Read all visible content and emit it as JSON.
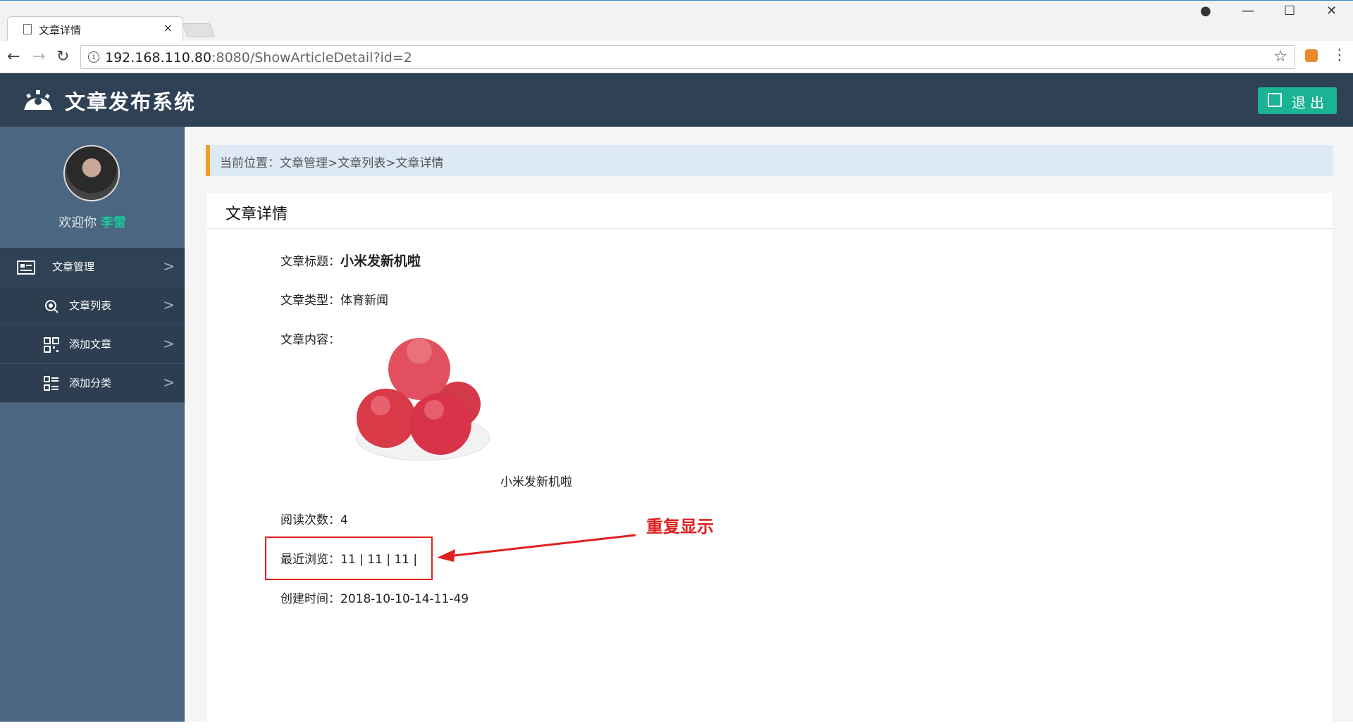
{
  "browser": {
    "tab_title": "文章详情",
    "tab_close": "×",
    "url_host": "192.168.110.80",
    "url_path": ":8080/ShowArticleDetail?id=2",
    "info_icon": "i",
    "star_icon": "☆",
    "menu_icon": "⋮",
    "window_controls": {
      "account": "●",
      "minimize": "—",
      "maximize": "☐",
      "close": "✕"
    },
    "nav": {
      "back": "←",
      "forward": "→",
      "reload": "↻"
    }
  },
  "header": {
    "app_title": "文章发布系统",
    "logout_label": "退出"
  },
  "sidebar": {
    "welcome_prefix": "欢迎你",
    "username": "李雷",
    "items": [
      {
        "label": "文章管理",
        "icon": "list-card-icon"
      },
      {
        "label": "文章列表",
        "icon": "search-doc-icon"
      },
      {
        "label": "添加文章",
        "icon": "grid-icon"
      },
      {
        "label": "添加分类",
        "icon": "category-icon"
      }
    ]
  },
  "breadcrumb": "当前位置：文章管理>文章列表>文章详情",
  "panel": {
    "title": "文章详情",
    "fields": {
      "title_label": "文章标题：",
      "title_value": "小米发新机啦",
      "type_label": "文章类型：",
      "type_value": "体育新闻",
      "content_label": "文章内容：",
      "content_caption": "小米发新机啦",
      "read_label": "阅读次数：",
      "read_value": "4",
      "recent_label": "最近浏览：",
      "recent_value": "11 | 11 | 11 |",
      "created_label": "创建时间：",
      "created_value": "2018-10-10-14-11-49"
    }
  },
  "annotation": {
    "text": "重复显示",
    "color": "#e02020"
  },
  "colors": {
    "header_bg": "#2f4154",
    "sidebar_bg": "#4b6680",
    "accent_green": "#1ab394",
    "breadcrumb_bar": "#f49b2a"
  }
}
